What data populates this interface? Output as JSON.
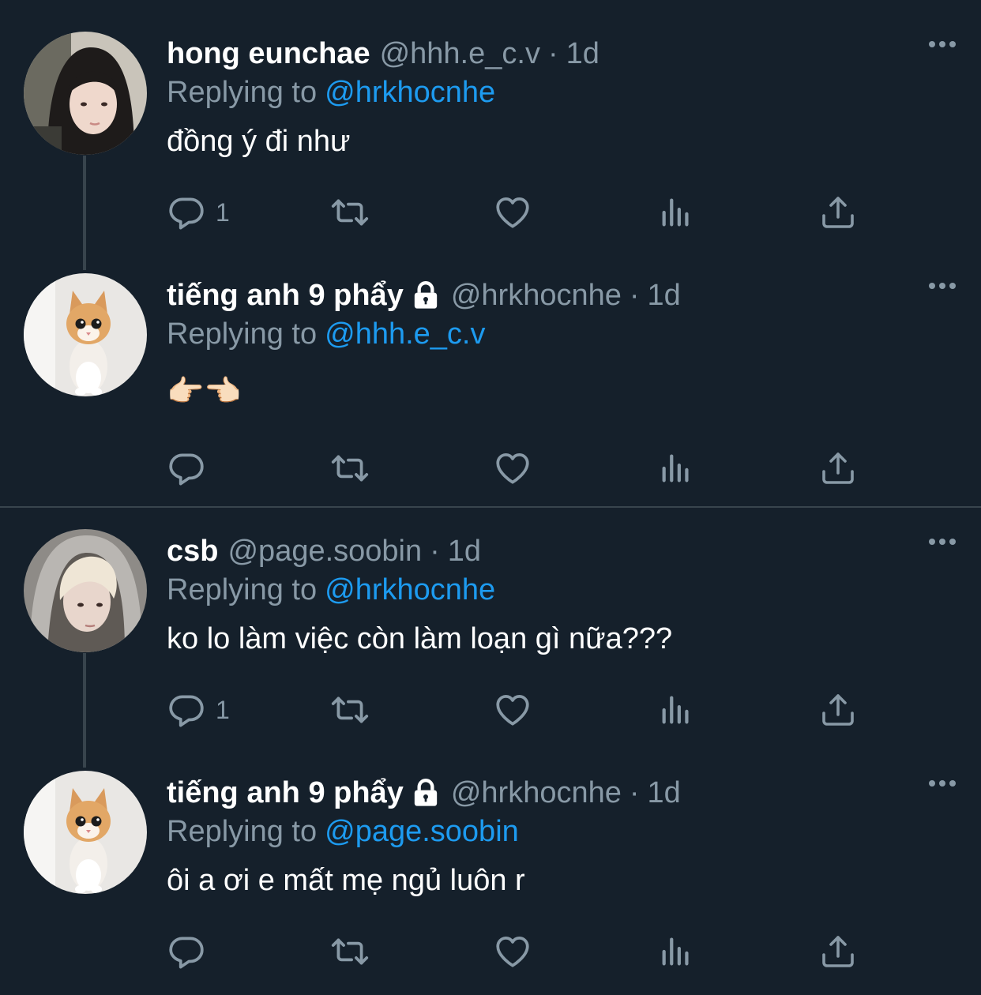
{
  "tweets": [
    {
      "name": "hong eunchae",
      "handle": "@hhh.e_c.v",
      "dot": "·",
      "time": "1d",
      "replying_prefix": "Replying to",
      "replying_to": "@hrkhocnhe",
      "text": "đồng ý đi như",
      "reply_count": "1",
      "locked": false,
      "avatar": "girl-portrait"
    },
    {
      "name": "tiếng anh 9 phẩy",
      "handle": "@hrkhocnhe",
      "dot": "·",
      "time": "1d",
      "replying_prefix": "Replying to",
      "replying_to": "@hhh.e_c.v",
      "text": "👉🏻👈🏻",
      "reply_count": "",
      "locked": true,
      "avatar": "kitten"
    },
    {
      "name": "csb",
      "handle": "@page.soobin",
      "dot": "·",
      "time": "1d",
      "replying_prefix": "Replying to",
      "replying_to": "@hrkhocnhe",
      "text": "ko lo làm việc còn làm loạn gì nữa???",
      "reply_count": "1",
      "locked": false,
      "avatar": "hooded-boy-portrait"
    },
    {
      "name": "tiếng anh 9 phẩy",
      "handle": "@hrkhocnhe",
      "dot": "·",
      "time": "1d",
      "replying_prefix": "Replying to",
      "replying_to": "@page.soobin",
      "text": "ôi a ơi e mất mẹ ngủ luôn r",
      "reply_count": "",
      "locked": true,
      "avatar": "kitten"
    }
  ],
  "icons": {
    "reply": "reply-icon",
    "retweet": "retweet-icon",
    "like": "heart-icon",
    "views": "analytics-icon",
    "share": "share-icon",
    "more": "more-icon",
    "lock": "lock-icon"
  },
  "colors": {
    "background": "#15202b",
    "text": "#ffffff",
    "secondary": "#8899a6",
    "link": "#1d9bf0",
    "divider": "#38444d"
  }
}
